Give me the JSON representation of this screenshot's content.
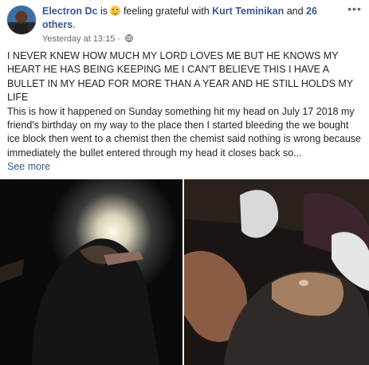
{
  "header": {
    "author": "Electron Dc",
    "is_word": "is",
    "feeling_text": "feeling grateful with",
    "tagged_person": "Kurt Teminikan",
    "and_word": "and",
    "others": "26 others",
    "period": ".",
    "timestamp": "Yesterday at 13:15",
    "dot": "·",
    "feeling_icon": "slightly-smiling-emoji",
    "privacy_icon": "globe-icon",
    "menu_icon": "more-options-icon"
  },
  "post": {
    "paragraph_1": "I NEVER KNEW HOW MUCH MY LORD LOVES ME BUT HE KNOWS MY HEART HE HAS BEING KEEPING ME I CAN'T BELIEVE THIS I HAVE A BULLET IN MY HEAD FOR MORE THAN A YEAR AND HE STILL HOLDS MY LIFE",
    "paragraph_2": "This is how it happened on Sunday something hit my head on July 17 2018 my friend's birthday on my way to the place then I started bleeding the we bought ice block then went to a chemist then the chemist said nothing is wrong because immediately the bullet entered through my head it closes back so...",
    "see_more": "See more"
  },
  "colors": {
    "link": "#385898",
    "text": "#1d2129",
    "meta": "#616770"
  }
}
